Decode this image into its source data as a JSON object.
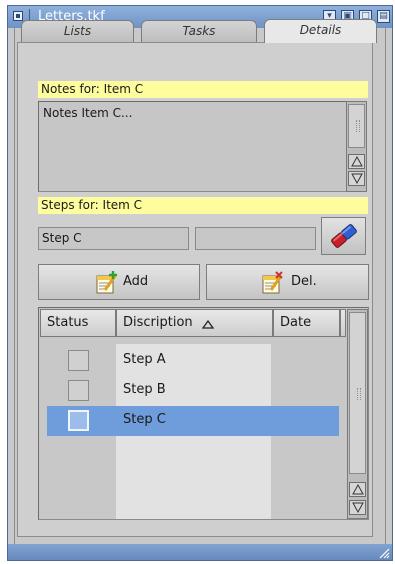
{
  "window": {
    "title": "Letters.tkf"
  },
  "tabs": [
    "Lists",
    "Tasks",
    "Details"
  ],
  "notes": {
    "label": "Notes for: Item C",
    "text": "Notes Item C..."
  },
  "steps": {
    "label": "Steps for: Item C",
    "step_value": "Step C",
    "second_value": "",
    "add_label": "Add",
    "del_label": "Del."
  },
  "table": {
    "headers": {
      "status": "Status",
      "description": "Discription",
      "date": "Date"
    },
    "sort_indicator": "ascending",
    "rows": [
      {
        "description": "Step A",
        "checked": false,
        "selected": false
      },
      {
        "description": "Step B",
        "checked": false,
        "selected": false
      },
      {
        "description": "Step C",
        "checked": false,
        "selected": true
      }
    ]
  },
  "icons": {
    "close": "close-gadget-icon",
    "eraser": "eraser-icon",
    "add": "notepad-add-icon",
    "delete": "notepad-delete-icon",
    "scroll_up": "arrow-up-icon",
    "scroll_down": "arrow-down-icon",
    "resize": "resize-grip-icon"
  },
  "colors": {
    "titlebar": "#7a9ccf",
    "highlight_label": "#fdfd9d",
    "selection": "#6f9ddb"
  }
}
